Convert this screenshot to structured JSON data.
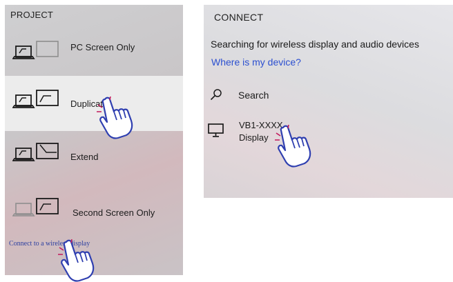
{
  "project": {
    "title": "PROJECT",
    "options": [
      {
        "label": "PC Screen Only"
      },
      {
        "label": "Duplicate",
        "selected": true
      },
      {
        "label": "Extend"
      },
      {
        "label": "Second Screen Only"
      }
    ],
    "wireless_link": "Connect to a wireless display"
  },
  "connect": {
    "title": "CONNECT",
    "status": "Searching for wireless display and audio devices",
    "help_link": "Where is my device?",
    "search_label": "Search",
    "device": {
      "name": "VB1-XXXX",
      "type": "Display"
    }
  },
  "icons": {
    "pc_screen_only": "laptop-and-gray-screen-icon",
    "duplicate": "laptop-and-duplicate-screen-icon",
    "extend": "laptop-and-extend-screen-icon",
    "second_screen_only": "gray-laptop-and-screen-icon",
    "search": "search-icon",
    "device": "monitor-icon",
    "pointer": "hand-pointer-icon"
  },
  "colors": {
    "link": "#2b4fd0",
    "pointer_outline": "#2f3fb0",
    "selected_row": "#ececec"
  }
}
